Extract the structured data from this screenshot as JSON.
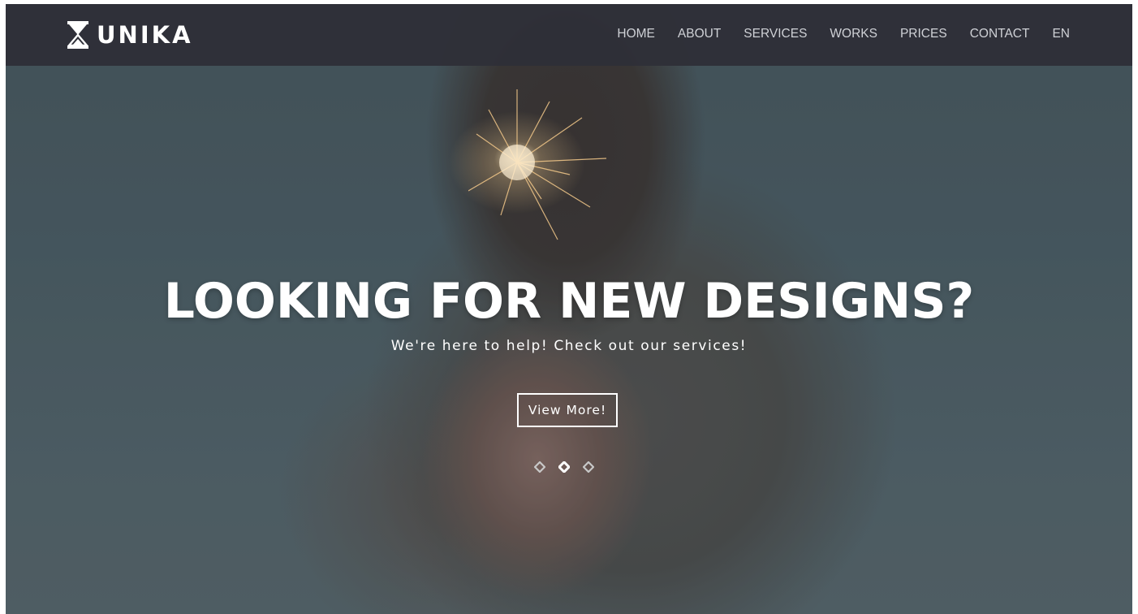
{
  "header": {
    "logo_text": "UNIKA",
    "nav": [
      {
        "label": "HOME"
      },
      {
        "label": "ABOUT"
      },
      {
        "label": "SERVICES"
      },
      {
        "label": "WORKS"
      },
      {
        "label": "PRICES"
      },
      {
        "label": "CONTACT"
      },
      {
        "label": "EN"
      }
    ]
  },
  "hero": {
    "headline": "LOOKING FOR NEW DESIGNS?",
    "subline": "We're here to help! Check out our services!",
    "button_label": "View More!",
    "slides": {
      "count": 3,
      "active": 2
    }
  },
  "colors": {
    "navbar": "#2e3038",
    "text": "#ffffff",
    "nav_text": "#cfd1d6"
  }
}
